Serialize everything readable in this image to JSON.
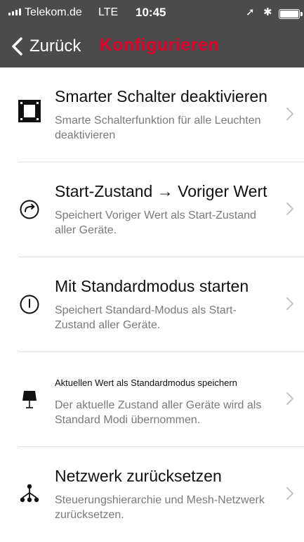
{
  "status_bar": {
    "carrier": "Telekom.de",
    "network": "LTE",
    "time": "10:45"
  },
  "nav": {
    "back_label": "Zurück",
    "title": "Konfigurieren"
  },
  "items": [
    {
      "title": "Smarter Schalter deaktivieren",
      "subtitle": "Smarte Schalterfunktion für alle Leuchten deaktivieren",
      "icon": "switch-icon"
    },
    {
      "title": "Start-Zustand → Voriger Wert",
      "subtitle": "Speichert Voriger Wert als Start-Zustand aller Geräte.",
      "icon": "circular-arrow-icon"
    },
    {
      "title": "Mit Standardmodus starten",
      "subtitle": "Speichert Standard-Modus als Start-Zustand aller Geräte.",
      "icon": "power-icon"
    },
    {
      "title": "Aktuellen Wert als Standardmodus speichern",
      "subtitle": "Der aktuelle Zustand aller Geräte wird als Standard Modi übernommen.",
      "icon": "lamp-icon"
    },
    {
      "title": "Netzwerk zurücksetzen",
      "subtitle": "Steuerungshierarchie und Mesh-Netzwerk zurücksetzen.",
      "icon": "network-tree-icon"
    }
  ],
  "colors": {
    "header_bg": "#4b4b4b",
    "title_accent": "#e4002b",
    "subtitle": "#7a7a7a",
    "separator": "#e2e2e2"
  }
}
